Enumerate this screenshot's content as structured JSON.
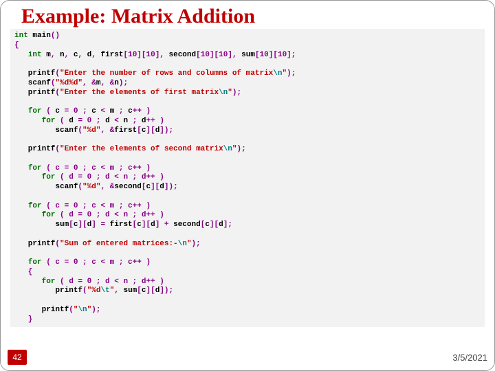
{
  "title": "Example: Matrix Addition",
  "code": {
    "l01a": "int",
    "l01b": " main",
    "l01c": "()",
    "l02": "{",
    "l03a": "int",
    "l03b": " m",
    "l03c": ",",
    "l03d": " n",
    "l03e": ",",
    "l03f": " c",
    "l03g": ",",
    "l03h": " d",
    "l03i": ",",
    "l03j": " first",
    "l03k": "[",
    "l03l": "10",
    "l03m": "][",
    "l03n": "10",
    "l03o": "],",
    "l03p": " second",
    "l03q": "[",
    "l03r": "10",
    "l03s": "][",
    "l03t": "10",
    "l03u": "],",
    "l03v": " sum",
    "l03w": "[",
    "l03x": "10",
    "l03y": "][",
    "l03z": "10",
    "l03aa": "];",
    "l05a": "   printf",
    "l05b": "(",
    "l05c": "\"Enter the number of rows and columns of matrix",
    "l05d": "\\n",
    "l05e": "\"",
    "l05f": ");",
    "l06a": "   scanf",
    "l06b": "(",
    "l06c": "\"%d%d\"",
    "l06d": ", &",
    "l06e": "m",
    "l06f": ", &",
    "l06g": "n",
    "l06h": ");",
    "l07a": "   printf",
    "l07b": "(",
    "l07c": "\"Enter the elements of first matrix",
    "l07d": "\\n",
    "l07e": "\"",
    "l07f": ");",
    "l09a": "for",
    "l09b": " (",
    "l09c": " c ",
    "l09d": "=",
    "l09e": " 0 ",
    "l09f": ";",
    "l09g": " c ",
    "l09h": "<",
    "l09i": " m ",
    "l09j": ";",
    "l09k": " c",
    "l09l": "++ )",
    "l10a": "for",
    "l10b": " (",
    "l10c": " d ",
    "l10d": "=",
    "l10e": " 0 ",
    "l10f": ";",
    "l10g": " d ",
    "l10h": "<",
    "l10i": " n ",
    "l10j": ";",
    "l10k": " d",
    "l10l": "++ )",
    "l11a": "         scanf",
    "l11b": "(",
    "l11c": "\"%d\"",
    "l11d": ", &",
    "l11e": "first",
    "l11f": "[",
    "l11g": "c",
    "l11h": "][",
    "l11i": "d",
    "l11j": "]);",
    "l13a": "   printf",
    "l13b": "(",
    "l13c": "\"Enter the elements of second matrix",
    "l13d": "\\n",
    "l13e": "\"",
    "l13f": ");",
    "l15a": "for",
    "l15b_txt": " ( c = 0 ; c < m ; c++ )",
    "l16a": "for",
    "l16b_txt": " ( d = 0 ; d < n ; d++ )",
    "l17a": "         scanf",
    "l17b": "(",
    "l17c": "\"%d\"",
    "l17d": ", &",
    "l17e": "second",
    "l17f": "[",
    "l17g": "c",
    "l17h": "][",
    "l17i": "d",
    "l17j": "]);",
    "l19a": "for",
    "l19b_txt": " ( c = 0 ; c < m ; c++ )",
    "l20a": "for",
    "l20b_txt": " ( d = 0 ; d < n ; d++ )",
    "l21a": "         sum",
    "l21b": "[",
    "l21c": "c",
    "l21d": "][",
    "l21e": "d",
    "l21f": "] = ",
    "l21g": "first",
    "l21h": "[",
    "l21i": "c",
    "l21j": "][",
    "l21k": "d",
    "l21l": "] + ",
    "l21m": "second",
    "l21n": "[",
    "l21o": "c",
    "l21p": "][",
    "l21q": "d",
    "l21r": "];",
    "l23a": "   printf",
    "l23b": "(",
    "l23c": "\"Sum of entered matrices:-",
    "l23d": "\\n",
    "l23e": "\"",
    "l23f": ");",
    "l25a": "for",
    "l25b_txt": " ( c = 0 ; c < m ; c++ )",
    "l26": "   {",
    "l27a": "for",
    "l27b_txt": " ( d = 0 ; d < n ; d++ )",
    "l28a": "         printf",
    "l28b": "(",
    "l28c": "\"%d",
    "l28d": "\\t",
    "l28e": "\"",
    "l28f": ", ",
    "l28g": "sum",
    "l28h": "[",
    "l28i": "c",
    "l28j": "][",
    "l28k": "d",
    "l28l": "]);",
    "l30a": "      printf",
    "l30b": "(",
    "l30c": "\"",
    "l30d": "\\n",
    "l30e": "\"",
    "l30f": ");",
    "l31": "   }"
  },
  "footer": {
    "page": "42",
    "date": "3/5/2021"
  }
}
